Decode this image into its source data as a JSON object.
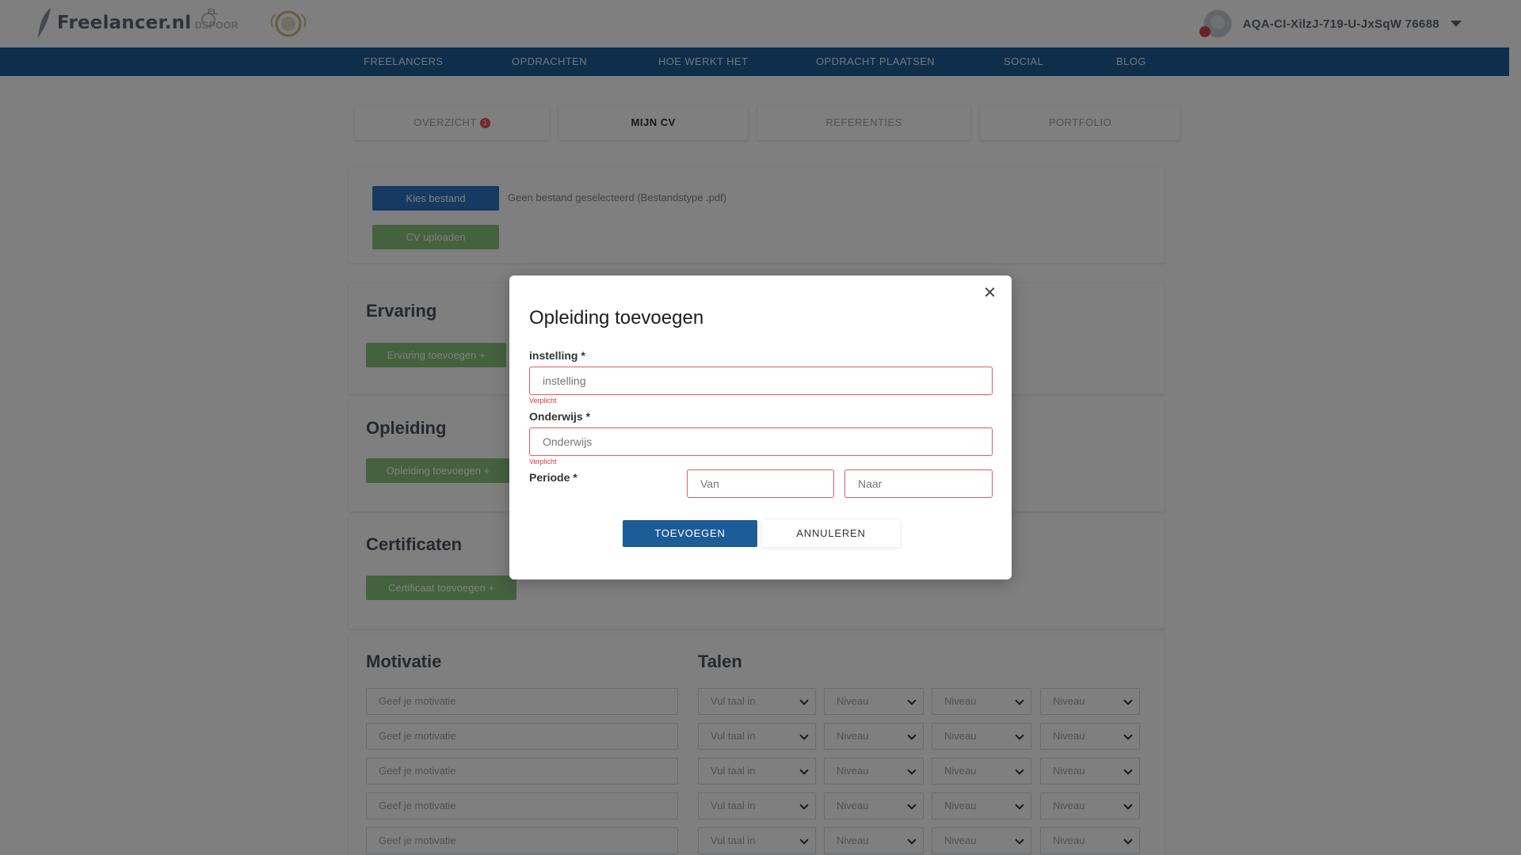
{
  "header": {
    "logo_text": "Freelancer.nl",
    "award_label_top": "EL",
    "award_label_bottom": "DSPOOR",
    "user_name": "AQA-CI-XilzJ-719-U-JxSqW 76688"
  },
  "nav": {
    "items": [
      "FREELANCERS",
      "OPDRACHTEN",
      "HOE WERKT HET",
      "OPDRACHT PLAATSEN",
      "SOCIAL",
      "BLOG"
    ]
  },
  "tabs": {
    "items": [
      {
        "label": "OVERZICHT",
        "badge": "1"
      },
      {
        "label": "MIJN CV"
      },
      {
        "label": "REFERENTIES"
      },
      {
        "label": "PORTFOLIO"
      }
    ]
  },
  "cv_upload": {
    "choose_file_label": "Kies bestand",
    "no_file_text": "Geen bestand geselecteerd (Bestandstype .pdf)",
    "upload_label": "CV uploaden"
  },
  "sections": {
    "ervaring": {
      "title": "Ervaring",
      "add_label": "Ervaring toevoegen +"
    },
    "opleiding": {
      "title": "Opleiding",
      "add_label": "Opleiding toevoegen +"
    },
    "certificaten": {
      "title": "Certificaten",
      "add_label": "Certificaat toevoegen +"
    },
    "motivatie": {
      "title": "Motivatie",
      "placeholder": "Geef je motivatie"
    },
    "talen": {
      "title": "Talen",
      "select_placeholder": "Vul taal in",
      "level_placeholder": "Niveau"
    }
  },
  "modal": {
    "title": "Opleiding toevoegen",
    "instelling_label": "instelling *",
    "instelling_placeholder": "instelling",
    "instelling_error": "Verplicht",
    "onderwijs_label": "Onderwijs *",
    "onderwijs_placeholder": "Onderwijs",
    "onderwijs_error": "Verplicht",
    "periode_label": "Periode *",
    "van_placeholder": "Van",
    "naar_placeholder": "Naar",
    "submit_label": "TOEVOEGEN",
    "cancel_label": "ANNULEREN"
  },
  "colors": {
    "nav_bg": "#1c5d97",
    "primary": "#1c5d97",
    "error": "#e05a5e",
    "green": "#88c57d"
  }
}
